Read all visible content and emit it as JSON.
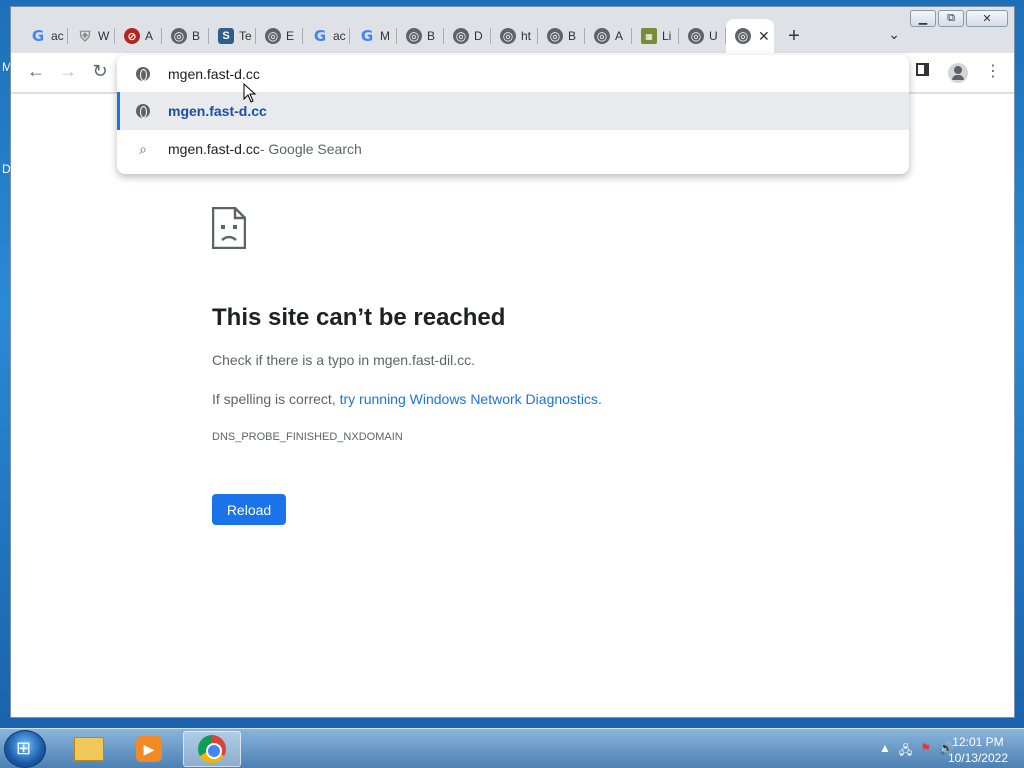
{
  "desktop": {
    "label_1": "M",
    "label_2": "D"
  },
  "tabs": [
    {
      "icon": "google-icon",
      "title": "ac"
    },
    {
      "icon": "shield-icon",
      "title": "W"
    },
    {
      "icon": "red-circle-icon",
      "title": "A"
    },
    {
      "icon": "globe-icon",
      "title": "B"
    },
    {
      "icon": "s-icon",
      "title": "Te"
    },
    {
      "icon": "globe-icon",
      "title": "E"
    },
    {
      "icon": "google-icon",
      "title": "ac"
    },
    {
      "icon": "google-icon",
      "title": "M"
    },
    {
      "icon": "globe-icon",
      "title": "B"
    },
    {
      "icon": "globe-icon",
      "title": "D"
    },
    {
      "icon": "globe-icon",
      "title": "ht"
    },
    {
      "icon": "globe-icon",
      "title": "B"
    },
    {
      "icon": "globe-icon",
      "title": "A"
    },
    {
      "icon": "image-icon",
      "title": "Li"
    },
    {
      "icon": "globe-icon",
      "title": "U"
    }
  ],
  "omnibox": {
    "input_value": "mgen.fast-d.cc",
    "suggestions": [
      {
        "text": "mgen.fast-d.cc",
        "suffix": ""
      },
      {
        "text": "mgen.fast-d.cc",
        "suffix": " - Google Search"
      }
    ]
  },
  "error_page": {
    "title": "This site can’t be reached",
    "check_text": "Check if there is a typo in mgen.fast-dil.cc.",
    "spelling_prefix": "If spelling is correct, ",
    "diagnostics_link": "try running Windows Network Diagnostics",
    "spelling_suffix": ".",
    "error_code": "DNS_PROBE_FINISHED_NXDOMAIN",
    "reload_label": "Reload"
  },
  "taskbar": {
    "time": "12:01 PM",
    "date": "10/13/2022"
  }
}
